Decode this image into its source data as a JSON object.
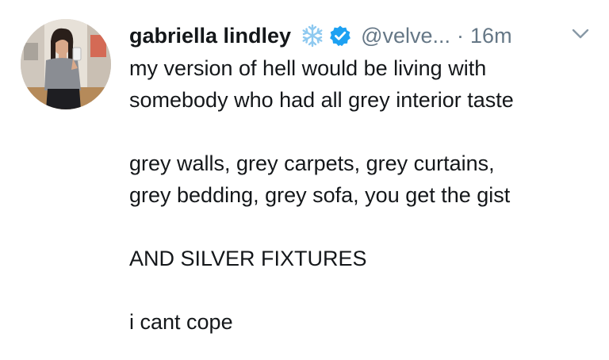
{
  "tweet": {
    "display_name": "gabriella lindley",
    "handle": "@velve...",
    "separator": "·",
    "time": "16m",
    "lines": {
      "l1": "my version of hell would be living with",
      "l2": "somebody who had all grey interior taste",
      "l3": "grey walls, grey carpets, grey curtains,",
      "l4": "grey bedding, grey sofa, you get the gist",
      "l5": "AND SILVER FIXTURES",
      "l6": "i cant cope"
    },
    "icons": {
      "name_emoji": "snowflake-icon",
      "verified": "verified-badge-icon",
      "menu": "chevron-down-icon"
    },
    "colors": {
      "text": "#14171a",
      "secondary": "#657786",
      "verified": "#1da1f2",
      "snowflake": "#8ec9f0"
    }
  }
}
